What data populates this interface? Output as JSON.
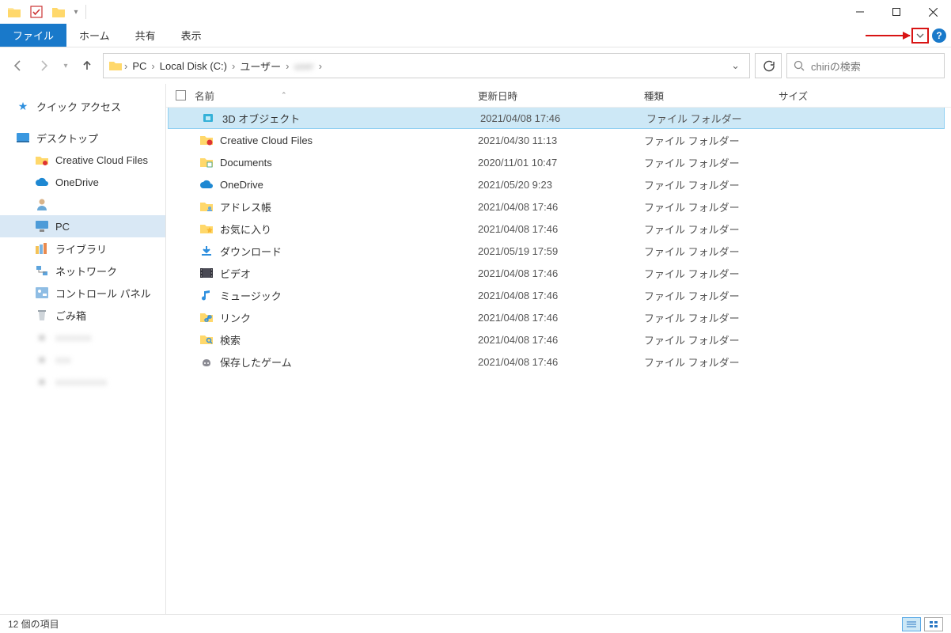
{
  "window": {
    "title": ""
  },
  "ribbon": {
    "file": "ファイル",
    "tabs": [
      "ホーム",
      "共有",
      "表示"
    ]
  },
  "nav": {
    "back": "←",
    "forward": "→",
    "up": "↑"
  },
  "breadcrumbs": {
    "items": [
      "PC",
      "Local Disk (C:)",
      "ユーザー"
    ]
  },
  "search": {
    "placeholder": "chiriの検索"
  },
  "sidebar": {
    "quick_access": "クイック アクセス",
    "desktop": "デスクトップ",
    "creative": "Creative Cloud Files",
    "onedrive": "OneDrive",
    "user": "",
    "pc": "PC",
    "libraries": "ライブラリ",
    "network": "ネットワーク",
    "control": "コントロール パネル",
    "recycle": "ごみ箱"
  },
  "columns": {
    "name": "名前",
    "date": "更新日時",
    "type": "種類",
    "size": "サイズ"
  },
  "rows": [
    {
      "icon": "3d",
      "name": "3D オブジェクト",
      "date": "2021/04/08 17:46",
      "type": "ファイル フォルダー"
    },
    {
      "icon": "cc",
      "name": "Creative Cloud Files",
      "date": "2021/04/30 11:13",
      "type": "ファイル フォルダー"
    },
    {
      "icon": "docs",
      "name": "Documents",
      "date": "2020/11/01 10:47",
      "type": "ファイル フォルダー"
    },
    {
      "icon": "onedrive",
      "name": "OneDrive",
      "date": "2021/05/20 9:23",
      "type": "ファイル フォルダー"
    },
    {
      "icon": "contacts",
      "name": "アドレス帳",
      "date": "2021/04/08 17:46",
      "type": "ファイル フォルダー"
    },
    {
      "icon": "fav",
      "name": "お気に入り",
      "date": "2021/04/08 17:46",
      "type": "ファイル フォルダー"
    },
    {
      "icon": "download",
      "name": "ダウンロード",
      "date": "2021/05/19 17:59",
      "type": "ファイル フォルダー"
    },
    {
      "icon": "video",
      "name": "ビデオ",
      "date": "2021/04/08 17:46",
      "type": "ファイル フォルダー"
    },
    {
      "icon": "music",
      "name": "ミュージック",
      "date": "2021/04/08 17:46",
      "type": "ファイル フォルダー"
    },
    {
      "icon": "link",
      "name": "リンク",
      "date": "2021/04/08 17:46",
      "type": "ファイル フォルダー"
    },
    {
      "icon": "search",
      "name": "検索",
      "date": "2021/04/08 17:46",
      "type": "ファイル フォルダー"
    },
    {
      "icon": "games",
      "name": "保存したゲーム",
      "date": "2021/04/08 17:46",
      "type": "ファイル フォルダー"
    }
  ],
  "status": {
    "count": "12 個の項目"
  }
}
